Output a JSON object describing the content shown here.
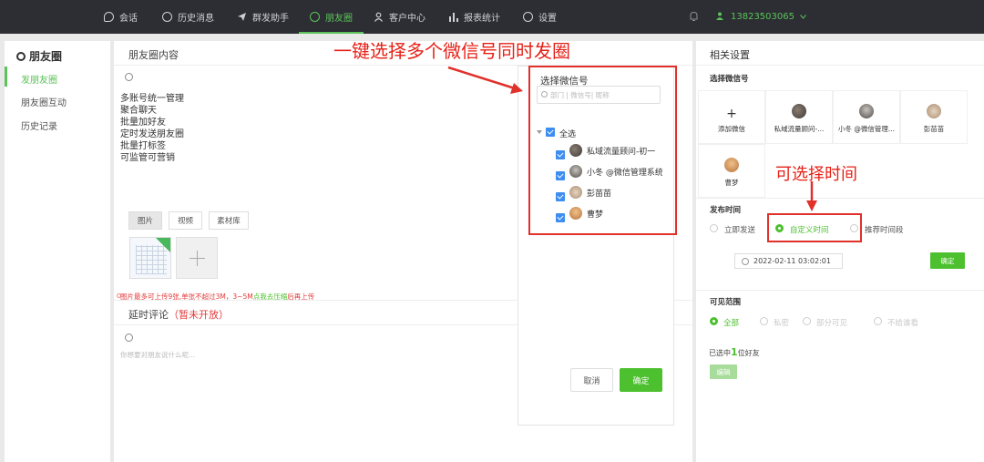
{
  "nav": {
    "items": [
      {
        "label": "会话",
        "icon": "chat-icon"
      },
      {
        "label": "历史消息",
        "icon": "clock-icon"
      },
      {
        "label": "群发助手",
        "icon": "send-icon"
      },
      {
        "label": "朋友圈",
        "icon": "moments-icon",
        "active": true
      },
      {
        "label": "客户中心",
        "icon": "user-icon"
      },
      {
        "label": "报表统计",
        "icon": "bar-chart-icon"
      },
      {
        "label": "设置",
        "icon": "gear-icon"
      }
    ],
    "phone": "13823503065"
  },
  "sidebar": {
    "title": "朋友圈",
    "items": [
      {
        "label": "发朋友圈",
        "active": true
      },
      {
        "label": "朋友圈互动"
      },
      {
        "label": "历史记录"
      }
    ]
  },
  "main": {
    "content_title": "朋友圈内容",
    "content_lines": [
      "多账号统一管理",
      "聚合聊天",
      "批量加好友",
      "定时发送朋友圈",
      "批量打标签",
      "可监管可营销"
    ],
    "tabs": [
      "图片",
      "视频",
      "素材库"
    ],
    "upload_tip": "图片最多可上传9张,单张不超过3M，3~5M点我去压缩后再上传",
    "upload_tip_link": "点我去压缩",
    "delay_comment_title": "延时评论",
    "delay_comment_note": "（暂未开放）",
    "comment_placeholder": "你想要对朋友说什么呢..."
  },
  "popup": {
    "title": "选择微信号",
    "search_placeholder": "部门 | 微信号| 昵称",
    "select_all": "全选",
    "accounts": [
      "私域流量顾问-初一",
      "小冬 @微信管理系统",
      "彭苗苗",
      "曹梦"
    ],
    "cancel": "取消",
    "confirm": "确定"
  },
  "settings": {
    "title": "相关设置",
    "select_account_label": "选择微信号",
    "add_account": "添加微信",
    "accounts": [
      "私域流量顾问-...",
      "小冬 @微信管理...",
      "彭苗苗",
      "曹梦"
    ],
    "publish_time_label": "发布时间",
    "time_options": [
      "立即发送",
      "自定义时间",
      "推荐时间段"
    ],
    "datetime": "2022-02-11 03:02:01",
    "confirm": "确定",
    "visibility_label": "可见范围",
    "visibility_options": [
      "全部",
      "私密",
      "部分可见",
      "不给谁看"
    ],
    "selected_prefix": "已选中",
    "selected_count": "1",
    "selected_suffix": "位好友",
    "edit": "编辑"
  },
  "annotations": {
    "multi_account": "一键选择多个微信号同时发圈",
    "time_select": "可选择时间"
  },
  "colors": {
    "accent_green": "#4cc02e",
    "annotation_red": "#e62117",
    "checkbox_blue": "#3d8ef0",
    "topbar": "#2c2e33"
  }
}
